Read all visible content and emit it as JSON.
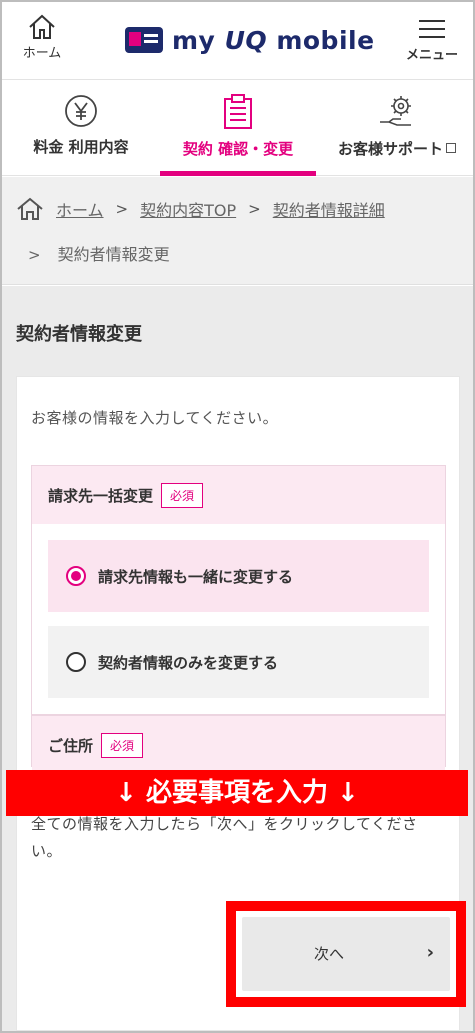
{
  "header": {
    "home_label": "ホーム",
    "logo_text_a": "my ",
    "logo_text_uq": "UQ",
    "logo_text_b": " mobile",
    "menu_label": "メニュー"
  },
  "nav": {
    "tabs": [
      {
        "label": "料金 利用内容",
        "icon": "yen-coin-icon",
        "active": false
      },
      {
        "label": "契約 確認・変更",
        "icon": "clipboard-icon",
        "active": true
      },
      {
        "label": "お客様サポート",
        "icon": "gear-hand-icon",
        "active": false,
        "external": true
      }
    ]
  },
  "breadcrumb": {
    "items": [
      "ホーム",
      "契約内容TOP",
      "契約者情報詳細"
    ],
    "current": "契約者情報変更",
    "separator": ">"
  },
  "page": {
    "title": "契約者情報変更",
    "intro": "お客様の情報を入力してください。",
    "required_badge": "必須",
    "billing_section": {
      "title": "請求先一括変更",
      "options": [
        {
          "label": "請求先情報も一緒に変更する",
          "selected": true
        },
        {
          "label": "契約者情報のみを変更する",
          "selected": false
        }
      ]
    },
    "address_section": {
      "title": "ご住所"
    },
    "notice": "全ての情報を入力したら「次へ」をクリックしてください。",
    "next_label": "次へ",
    "next_chevron": "›"
  },
  "annotation": {
    "text": "↓ 必要事項を入力 ↓"
  },
  "colors": {
    "accent": "#e3007f",
    "brand": "#1d2a6b",
    "annotation_red": "#ff0000"
  }
}
